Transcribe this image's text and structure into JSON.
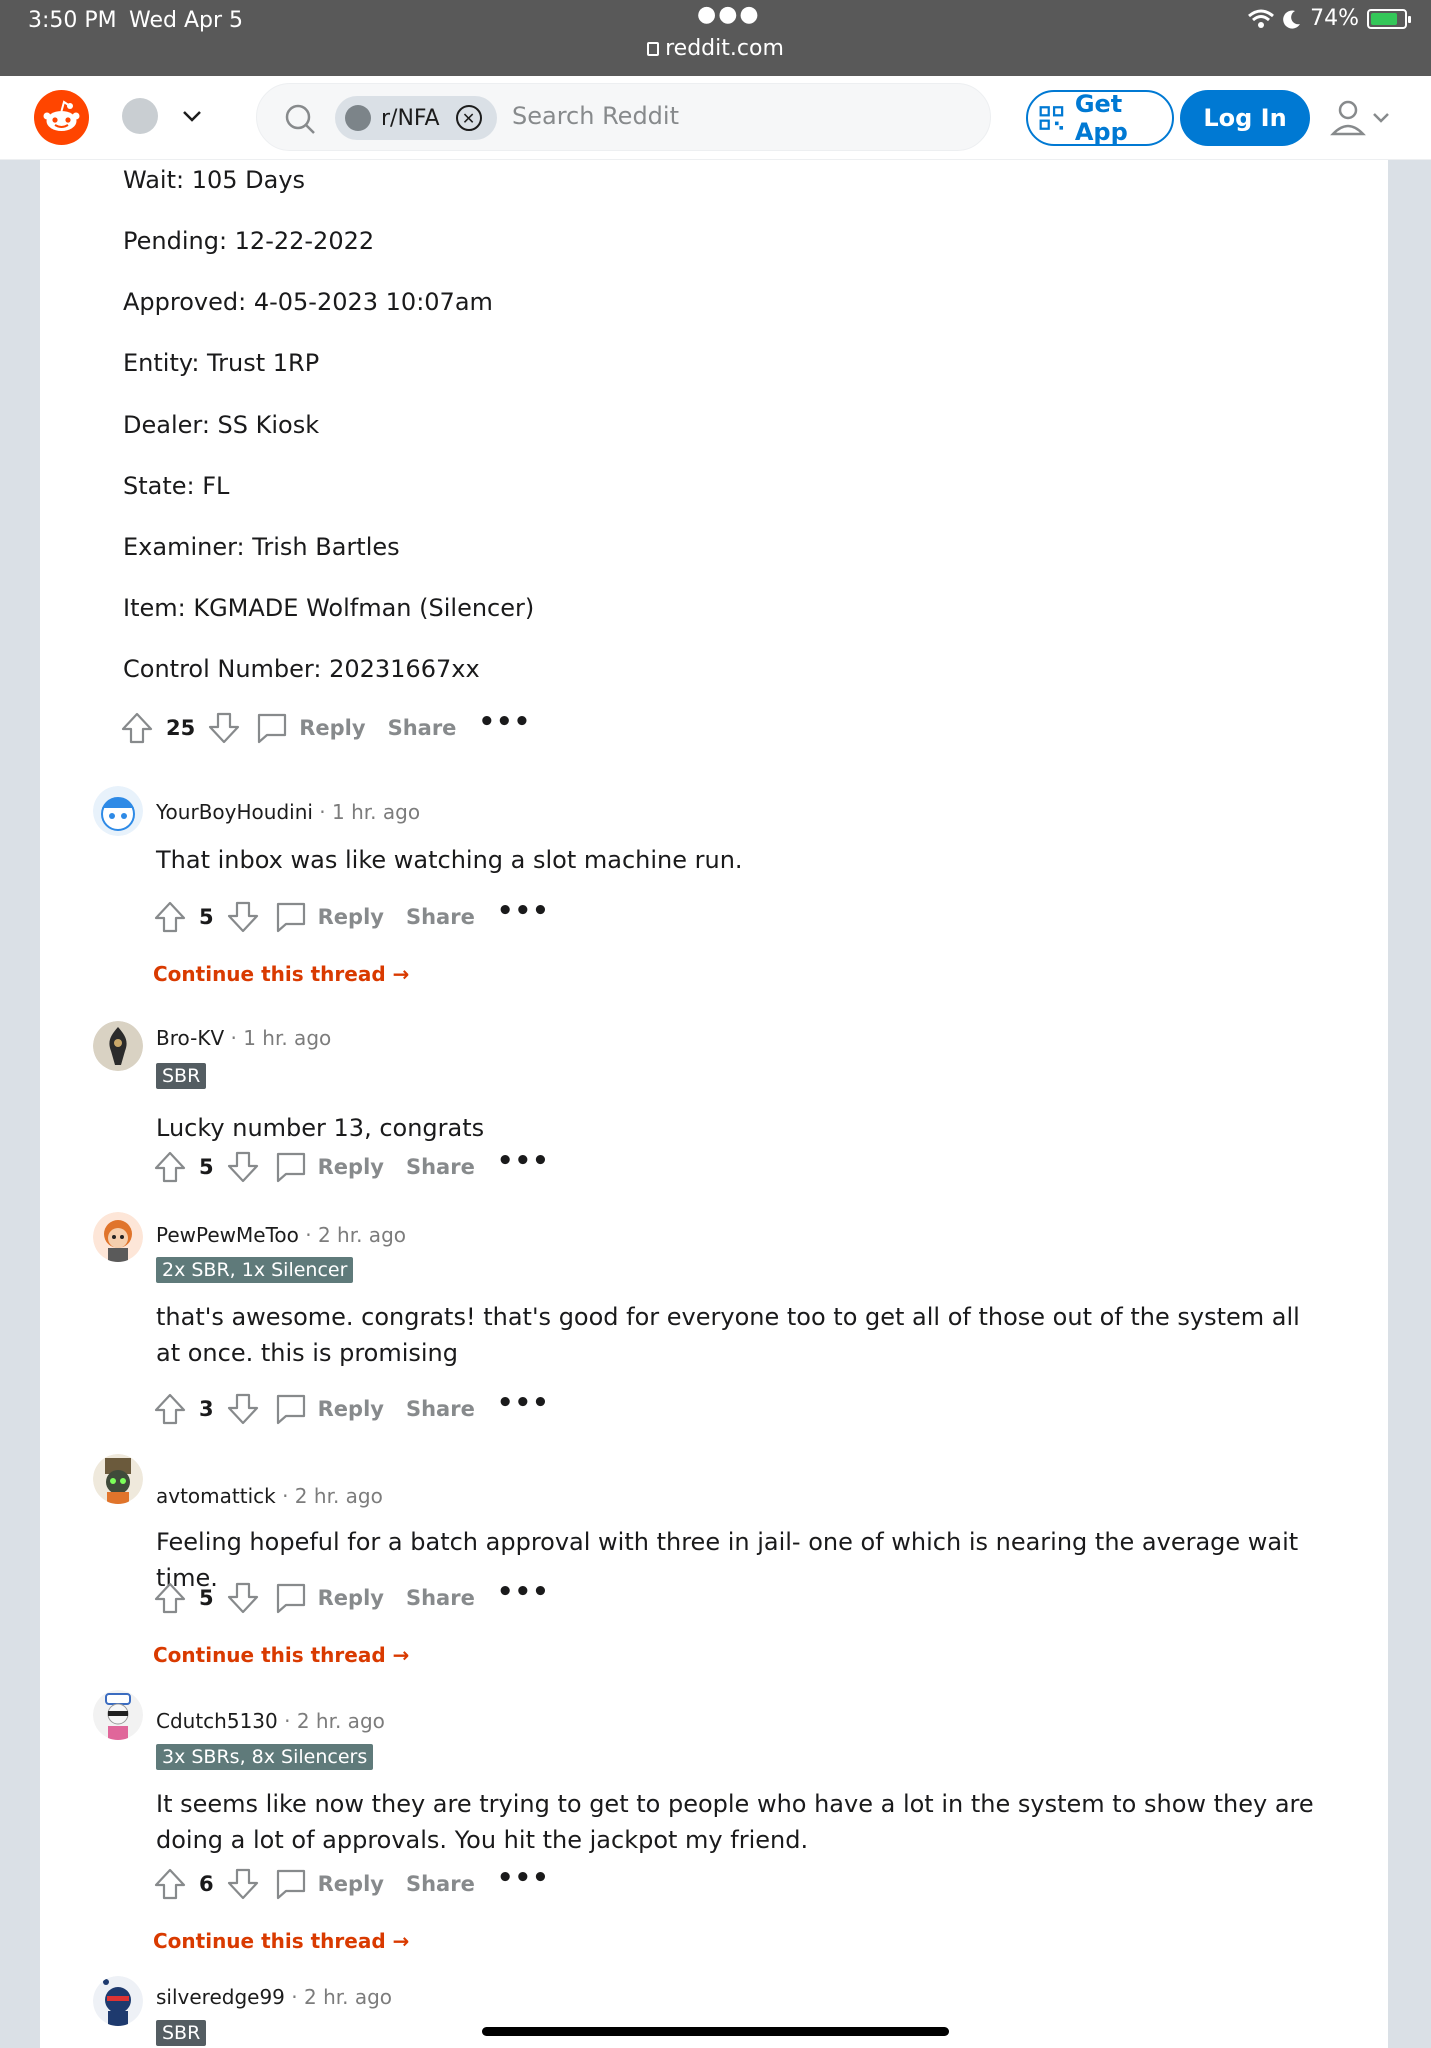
{
  "status_bar": {
    "time": "3:50 PM",
    "date": "Wed Apr 5",
    "url": "reddit.com",
    "battery": "74%"
  },
  "header": {
    "subreddit_chip": "r/NFA",
    "search_placeholder": "Search Reddit",
    "get_app": "Get App",
    "log_in": "Log In"
  },
  "post": {
    "lines": [
      "Wait: 105 Days",
      "Pending: 12-22-2022",
      "Approved: 4-05-2023 10:07am",
      "Entity: Trust 1RP",
      "Dealer: SS Kiosk",
      "State: FL",
      "Examiner: Trish Bartles",
      "Item: KGMADE Wolfman (Silencer)",
      "Control Number: 20231667xx"
    ],
    "score": "25",
    "reply": "Reply",
    "share": "Share"
  },
  "comments": [
    {
      "user": "YourBoyHoudini",
      "time": "· 1 hr. ago",
      "flair": "",
      "body": "That inbox was like watching a slot machine run.",
      "score": "5",
      "continue": "Continue this thread"
    },
    {
      "user": "Bro-KV",
      "time": "· 1 hr. ago",
      "flair": "SBR",
      "body": "Lucky number 13, congrats",
      "score": "5",
      "continue": ""
    },
    {
      "user": "PewPewMeToo",
      "time": "· 2 hr. ago",
      "flair": "2x SBR, 1x Silencer",
      "body": "that's awesome. congrats! that's good for everyone too to get all of those out of the system all at once. this is promising",
      "score": "3",
      "continue": ""
    },
    {
      "user": "avtomattick",
      "time": "· 2 hr. ago",
      "flair": "",
      "body": "Feeling hopeful for a batch approval with three in jail- one of which is nearing the average wait time.",
      "score": "5",
      "continue": "Continue this thread"
    },
    {
      "user": "Cdutch5130",
      "time": "· 2 hr. ago",
      "flair": "3x SBRs, 8x Silencers",
      "body": "It seems like now they are trying to get to people who have a lot in the system to show they are doing a lot of approvals. You hit the jackpot my friend.",
      "score": "6",
      "continue": "Continue this thread"
    },
    {
      "user": "silveredge99",
      "time": "· 2 hr. ago",
      "flair": "SBR",
      "body": "",
      "score": "",
      "continue": ""
    }
  ],
  "labels": {
    "reply": "Reply",
    "share": "Share",
    "more": "•••",
    "arrow": "→"
  }
}
